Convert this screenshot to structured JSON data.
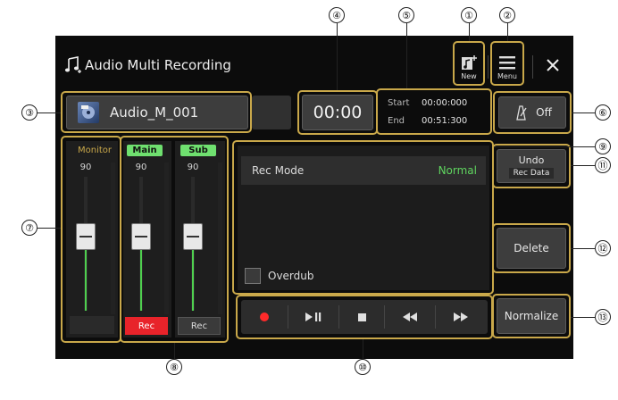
{
  "header": {
    "title": "Audio Multi Recording",
    "new_label": "New",
    "menu_label": "Menu"
  },
  "file": {
    "name": "Audio_M_001"
  },
  "time": {
    "current": "00:00",
    "start_label": "Start",
    "start_value": "00:00:000",
    "end_label": "End",
    "end_value": "00:51:300"
  },
  "metronome": {
    "state": "Off"
  },
  "channels": [
    {
      "label": "Monitor",
      "value": "90"
    },
    {
      "label": "Main",
      "value": "90",
      "rec_label": "Rec"
    },
    {
      "label": "Sub",
      "value": "90",
      "rec_label": "Rec"
    }
  ],
  "rec_panel": {
    "mode_label": "Rec Mode",
    "mode_value": "Normal",
    "overdub_label": "Overdub"
  },
  "side_buttons": {
    "undo_line1": "Undo",
    "undo_line2": "Rec Data",
    "delete": "Delete",
    "normalize": "Normalize"
  },
  "callouts": [
    "①",
    "②",
    "③",
    "④",
    "⑤",
    "⑥",
    "⑦",
    "⑧",
    "⑨",
    "⑩",
    "⑪",
    "⑫",
    "⑬"
  ],
  "colors": {
    "accent_green": "#5fd55f",
    "rec_red": "#e8232a",
    "callout_gold": "#c9a84a",
    "record_dot": "#ff2a2a"
  },
  "icons": {
    "app": "music-notes-icon",
    "new": "new-song-icon",
    "menu": "hamburger-icon",
    "close": "close-icon",
    "metronome": "metronome-icon",
    "record": "record-icon",
    "play": "play-pause-icon",
    "stop": "stop-icon",
    "rewind": "rewind-icon",
    "forward": "fast-forward-icon"
  }
}
